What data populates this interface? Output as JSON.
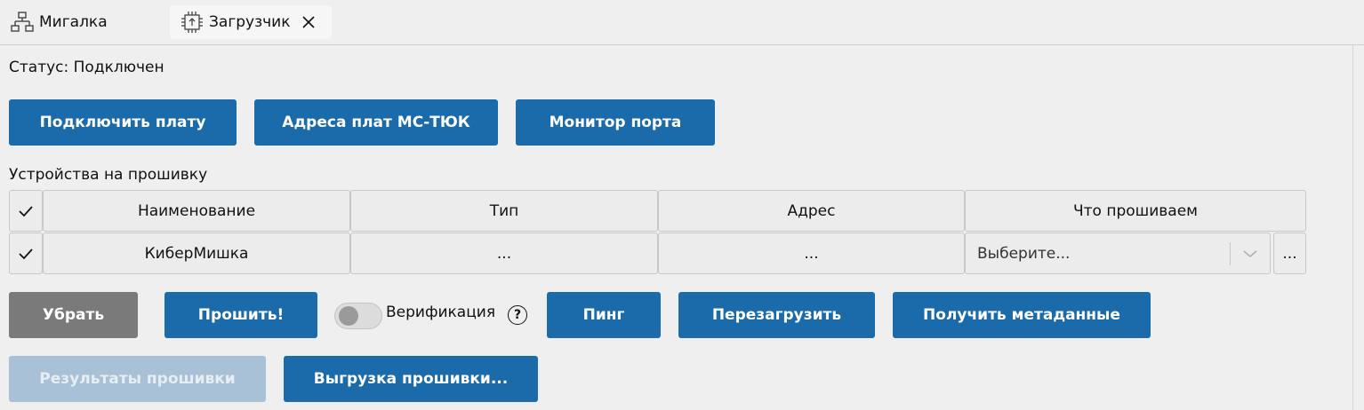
{
  "tabs": [
    {
      "label": "Мигалка",
      "icon": "network-icon"
    },
    {
      "label": "Загрузчик",
      "icon": "chip-upload-icon"
    }
  ],
  "status": "Статус: Подключен",
  "top_buttons": {
    "connect": "Подключить плату",
    "addresses": "Адреса плат МС-ТЮК",
    "monitor": "Монитор порта"
  },
  "devices_label": "Устройства на прошивку",
  "table": {
    "headers": [
      "Наименование",
      "Тип",
      "Адрес",
      "Что прошиваем"
    ],
    "rows": [
      {
        "name": "КиберМишка",
        "type": "...",
        "address": "...",
        "firmware_placeholder": "Выберите...",
        "more": "..."
      }
    ]
  },
  "actions": {
    "remove": "Убрать",
    "flash": "Прошить!",
    "verify_label": "Верификация",
    "verify_help": "?",
    "ping": "Пинг",
    "reboot": "Перезагрузить",
    "metadata": "Получить метаданные",
    "results": "Результаты прошивки",
    "export": "Выгрузка прошивки..."
  },
  "colors": {
    "accent": "#1b6aaa",
    "gray_button": "#7a7a7a",
    "disabled_button": "#a9c1d6"
  }
}
